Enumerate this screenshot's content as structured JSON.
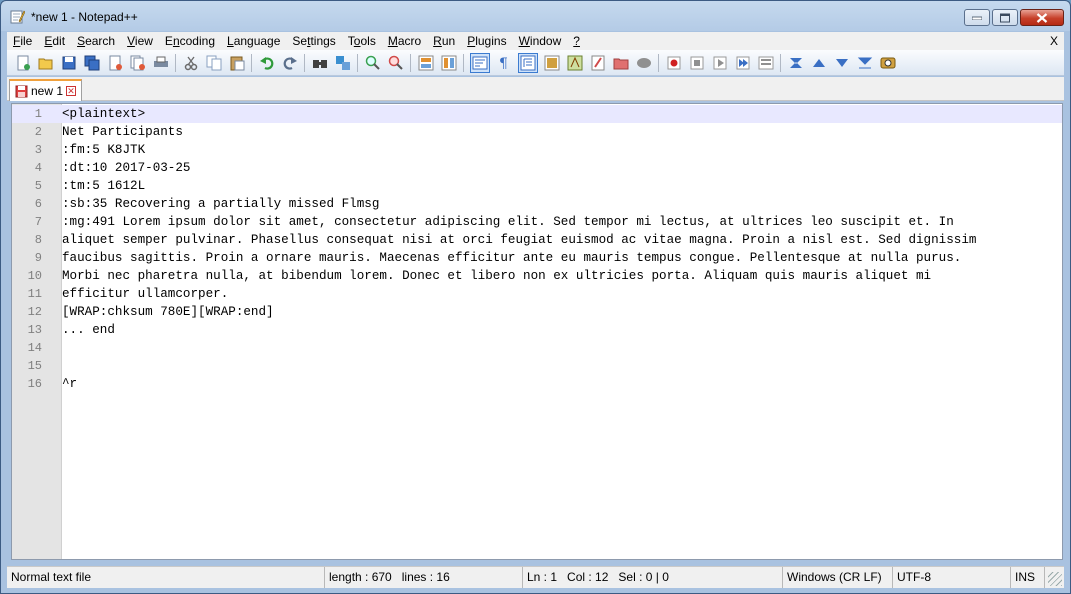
{
  "window": {
    "title": "*new 1 - Notepad++",
    "menu_close": "X"
  },
  "menu": [
    {
      "label": "File",
      "hot": "F",
      "rest": "ile"
    },
    {
      "label": "Edit",
      "hot": "E",
      "rest": "dit"
    },
    {
      "label": "Search",
      "hot": "S",
      "rest": "earch"
    },
    {
      "label": "View",
      "hot": "V",
      "rest": "iew"
    },
    {
      "label": "Encoding",
      "hot": "n",
      "pre": "E",
      "rest": "coding"
    },
    {
      "label": "Language",
      "hot": "L",
      "rest": "anguage"
    },
    {
      "label": "Settings",
      "hot": "t",
      "pre": "Se",
      "rest": "tings"
    },
    {
      "label": "Tools",
      "hot": "o",
      "pre": "T",
      "rest": "ols"
    },
    {
      "label": "Macro",
      "hot": "M",
      "rest": "acro"
    },
    {
      "label": "Run",
      "hot": "R",
      "rest": "un"
    },
    {
      "label": "Plugins",
      "hot": "P",
      "rest": "lugins"
    },
    {
      "label": "Window",
      "hot": "W",
      "rest": "indow"
    },
    {
      "label": "?",
      "hot": "?",
      "rest": ""
    }
  ],
  "toolbar": [
    {
      "name": "new-file",
      "color": "#ffffff"
    },
    {
      "name": "open-file",
      "color": "#f2c94c"
    },
    {
      "name": "save",
      "color": "#3a6fc4"
    },
    {
      "name": "save-all",
      "color": "#3a6fc4"
    },
    {
      "name": "close",
      "color": "#e05a3a"
    },
    {
      "name": "close-all",
      "color": "#e05a3a"
    },
    {
      "name": "print",
      "color": "#7a8aa0"
    },
    {
      "sep": true
    },
    {
      "name": "cut",
      "color": "#6a6a6a"
    },
    {
      "name": "copy",
      "color": "#8aa0c0"
    },
    {
      "name": "paste",
      "color": "#c8a060"
    },
    {
      "sep": true
    },
    {
      "name": "undo",
      "color": "#2f9a3a"
    },
    {
      "name": "redo",
      "color": "#5a6f8c"
    },
    {
      "sep": true
    },
    {
      "name": "find",
      "color": "#404040"
    },
    {
      "name": "replace",
      "color": "#3a8fd0"
    },
    {
      "sep": true
    },
    {
      "name": "zoom-in",
      "color": "#3aa050"
    },
    {
      "name": "zoom-out",
      "color": "#d04a4a"
    },
    {
      "sep": true
    },
    {
      "name": "sync-vertical",
      "color": "#e09030"
    },
    {
      "name": "sync-horizontal",
      "color": "#e09030"
    },
    {
      "sep": true
    },
    {
      "name": "word-wrap",
      "color": "#3a6fc4",
      "active": true
    },
    {
      "name": "show-all-chars",
      "color": "#3a6fc4"
    },
    {
      "name": "indent-guide",
      "color": "#3a6fc4",
      "active": true
    },
    {
      "name": "language-define",
      "color": "#d0a040"
    },
    {
      "name": "document-map",
      "color": "#80a040"
    },
    {
      "name": "function-list",
      "color": "#d04a4a"
    },
    {
      "name": "folder-as-workspace",
      "color": "#e07070"
    },
    {
      "name": "monitoring",
      "color": "#909090"
    },
    {
      "sep": true
    },
    {
      "name": "record-macro",
      "color": "#d02020"
    },
    {
      "name": "stop-record",
      "color": "#909090"
    },
    {
      "name": "play-macro",
      "color": "#909090"
    },
    {
      "name": "play-multiple",
      "color": "#3a6fc4"
    },
    {
      "name": "save-macro",
      "color": "#909090"
    },
    {
      "sep": true
    },
    {
      "name": "fldigi-first",
      "color": "#3a6fc4"
    },
    {
      "name": "fldigi-up",
      "color": "#3a6fc4"
    },
    {
      "name": "fldigi-down",
      "color": "#3a6fc4"
    },
    {
      "name": "fldigi-last",
      "color": "#3a6fc4"
    },
    {
      "name": "fldigi-tool",
      "color": "#d0a040"
    }
  ],
  "tab": {
    "label": "new 1"
  },
  "editor": {
    "lines": [
      {
        "n": "1",
        "text": "<plaintext>",
        "current": true
      },
      {
        "n": "2",
        "text": "Net Participants"
      },
      {
        "n": "3",
        "text": ":fm:5 K8JTK"
      },
      {
        "n": "4",
        "text": ":dt:10 2017-03-25"
      },
      {
        "n": "5",
        "text": ":tm:5 1612L"
      },
      {
        "n": "6",
        "text": ":sb:35 Recovering a partially missed Flmsg"
      },
      {
        "n": "7",
        "text": ":mg:491 Lorem ipsum dolor sit amet, consectetur adipiscing elit. Sed tempor mi lectus, at ultrices leo suscipit et. In"
      },
      {
        "n": "8",
        "text": "aliquet semper pulvinar. Phasellus consequat nisi at orci feugiat euismod ac vitae magna. Proin a nisl est. Sed dignissim"
      },
      {
        "n": "9",
        "text": "faucibus sagittis. Proin a ornare mauris. Maecenas efficitur ante eu mauris tempus congue. Pellentesque at nulla purus."
      },
      {
        "n": "10",
        "text": "Morbi nec pharetra nulla, at bibendum lorem. Donec et libero non ex ultricies porta. Aliquam quis mauris aliquet mi"
      },
      {
        "n": "11",
        "text": "efficitur ullamcorper."
      },
      {
        "n": "12",
        "text": "[WRAP:chksum 780E][WRAP:end]"
      },
      {
        "n": "13",
        "text": "... end"
      },
      {
        "n": "14",
        "text": ""
      },
      {
        "n": "15",
        "text": ""
      },
      {
        "n": "16",
        "text": "^r"
      }
    ]
  },
  "status": {
    "file_type": "Normal text file",
    "length": "length : 670",
    "lines": "lines : 16",
    "ln": "Ln : 1",
    "col": "Col : 12",
    "sel": "Sel : 0 | 0",
    "eol": "Windows (CR LF)",
    "encoding": "UTF-8",
    "mode": "INS"
  }
}
